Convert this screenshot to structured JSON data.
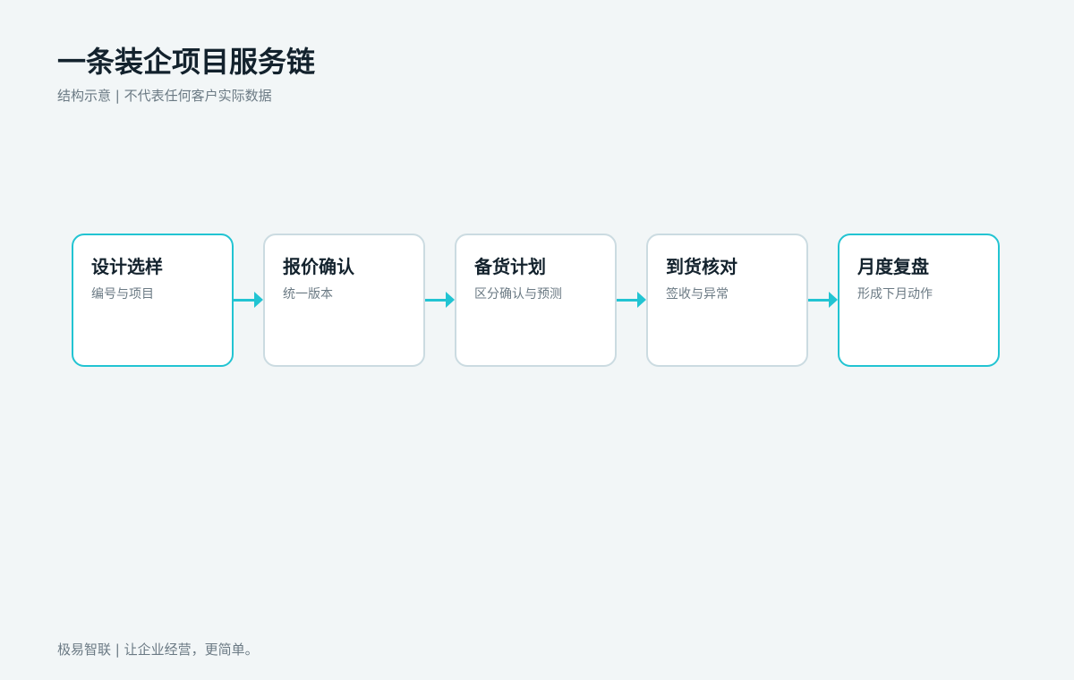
{
  "header": {
    "title": "一条装企项目服务链",
    "subtitle": "结构示意 | 不代表任何客户实际数据"
  },
  "steps": [
    {
      "title": "设计选样",
      "subtitle": "编号与项目",
      "highlight": true
    },
    {
      "title": "报价确认",
      "subtitle": "统一版本",
      "highlight": false
    },
    {
      "title": "备货计划",
      "subtitle": "区分确认与预测",
      "highlight": false
    },
    {
      "title": "到货核对",
      "subtitle": "签收与异常",
      "highlight": false
    },
    {
      "title": "月度复盘",
      "subtitle": "形成下月动作",
      "highlight": true
    }
  ],
  "footer": {
    "text": "极易智联 | 让企业经营，更简单。"
  },
  "colors": {
    "accent": "#22c4d2",
    "card_border": "#cbdbe1",
    "background": "#f2f6f7",
    "title_text": "#13222d",
    "muted_text": "#6b7a84"
  }
}
